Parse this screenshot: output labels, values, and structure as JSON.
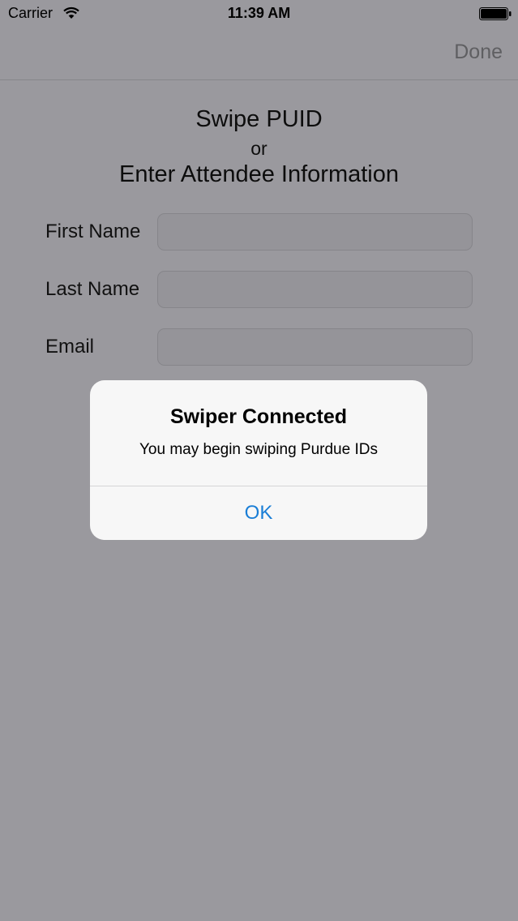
{
  "status_bar": {
    "carrier": "Carrier",
    "time": "11:39 AM",
    "icons": [
      "wifi-icon",
      "battery-icon"
    ]
  },
  "nav_bar": {
    "done_label": "Done"
  },
  "header": {
    "line1": "Swipe PUID",
    "line2": "or",
    "line3": "Enter Attendee Information"
  },
  "form": {
    "first_name_label": "First Name",
    "first_name_value": "",
    "last_name_label": "Last Name",
    "last_name_value": "",
    "email_label": "Email",
    "email_value": ""
  },
  "alert": {
    "title": "Swiper Connected",
    "message": "You may begin swiping Purdue IDs",
    "ok_label": "OK"
  },
  "colors": {
    "dimmed_background": "#9a999e",
    "alert_background": "#f7f7f7",
    "alert_button": "#1a7ed6"
  }
}
